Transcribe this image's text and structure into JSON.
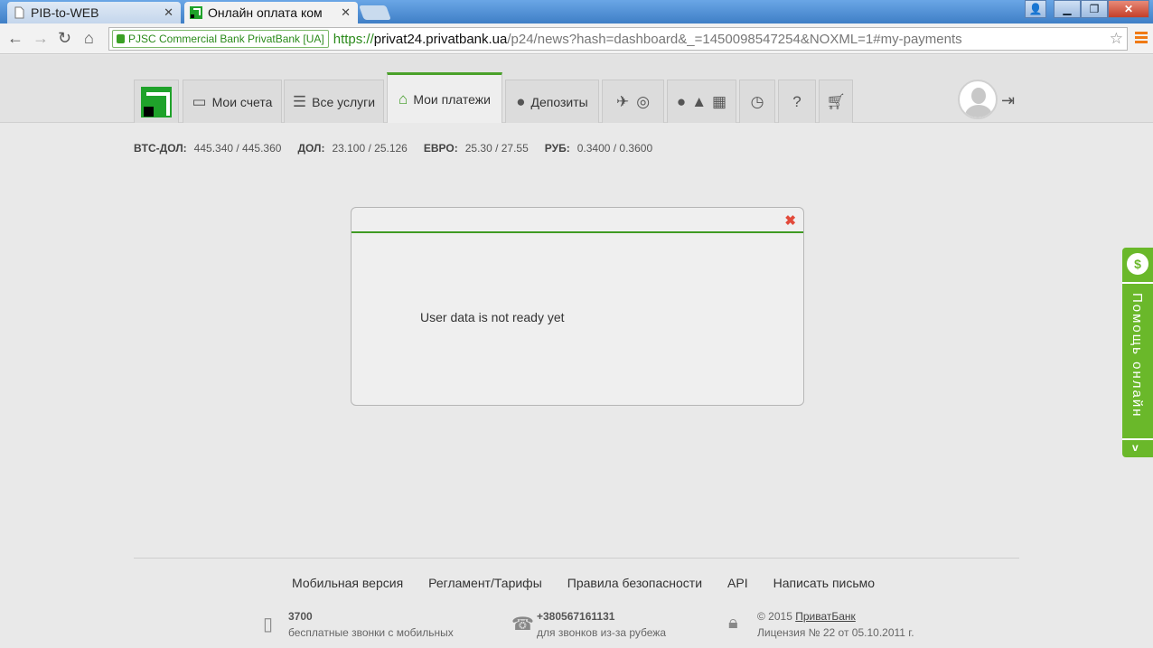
{
  "browser": {
    "tabs": [
      {
        "title": "PIB-to-WEB",
        "active": false
      },
      {
        "title": "Онлайн оплата ком",
        "active": true
      }
    ],
    "ev_label": "PJSC Commercial Bank PrivatBank [UA]",
    "url": {
      "proto": "https://",
      "host": "privat24.privatbank.ua",
      "path": "/p24/news?hash=dashboard&_=1450098547254&NOXML=1#my-payments"
    }
  },
  "nav": {
    "items": [
      {
        "label": "Мои счета",
        "icon": "card-icon"
      },
      {
        "label": "Все услуги",
        "icon": "list-icon"
      },
      {
        "label": "Мои платежи",
        "icon": "home-icon"
      },
      {
        "label": "Депозиты",
        "icon": "piggybank-icon"
      }
    ]
  },
  "rates": [
    {
      "label": "BTC-ДОЛ:",
      "value": "445.340 / 445.360"
    },
    {
      "label": "ДОЛ:",
      "value": "23.100 / 25.126"
    },
    {
      "label": "ЕВРО:",
      "value": "25.30 / 27.55"
    },
    {
      "label": "РУБ:",
      "value": "0.3400 / 0.3600"
    }
  ],
  "modal": {
    "message": "User data is not ready yet",
    "close": "✖"
  },
  "help": {
    "label": "Помощь онлайн",
    "arrow": "v"
  },
  "footer": {
    "links": [
      "Мобильная версия",
      "Регламент/Тарифы",
      "Правила безопасности",
      "API",
      "Написать письмо"
    ],
    "phone1": {
      "number": "3700",
      "desc": "бесплатные звонки с мобильных"
    },
    "phone2": {
      "number": "+380567161131",
      "desc": "для звонков из-за рубежа"
    },
    "copyright": {
      "year": "© 2015",
      "brand": "ПриватБанк",
      "license": "Лицензия № 22 от 05.10.2011 г."
    }
  },
  "colors": {
    "accent": "#3f9b23",
    "help": "#6ab82a",
    "close": "#e24a3a"
  }
}
